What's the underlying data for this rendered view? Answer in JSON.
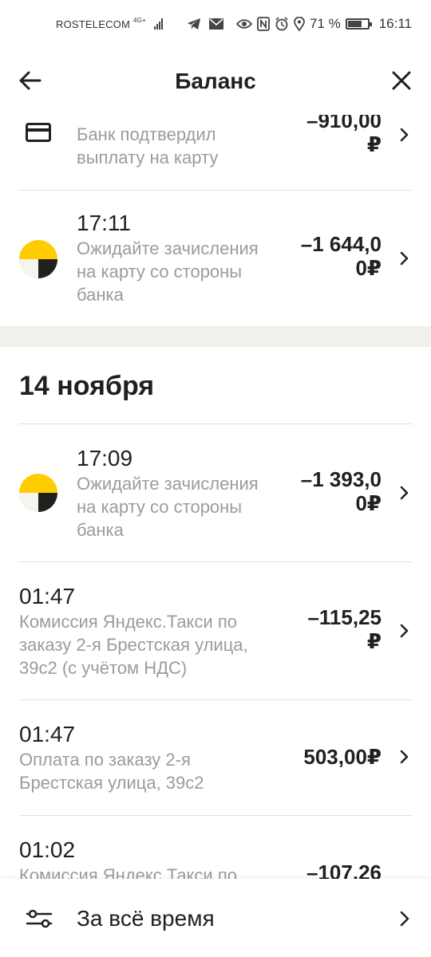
{
  "status": {
    "carrier": "ROSTELECOM",
    "network": "4G+",
    "battery": "71 %",
    "time": "16:11"
  },
  "header": {
    "title": "Баланс"
  },
  "rows_top": [
    {
      "icon": "card-icon",
      "time": "",
      "desc": "Банк подтвердил выплату на карту",
      "amount_line1": "–910,00",
      "amount_line2": "₽"
    },
    {
      "icon": "yandex-logo-icon",
      "time": "17:11",
      "desc": "Ожидайте зачисления на карту со стороны банка",
      "amount_line1": "–1 644,0",
      "amount_line2": "0₽"
    }
  ],
  "section": {
    "date": "14 ноября"
  },
  "rows": [
    {
      "icon": "yandex-logo-icon",
      "time": "17:09",
      "desc": "Ожидайте зачисления на карту со стороны банка",
      "amount_line1": "–1 393,0",
      "amount_line2": "0₽"
    },
    {
      "icon": "",
      "time": "01:47",
      "desc": "Комиссия Яндекс.Такси по заказу 2-я Брестская улица, 39с2 (с учётом НДС)",
      "amount_line1": "–115,25",
      "amount_line2": "₽"
    },
    {
      "icon": "",
      "time": "01:47",
      "desc": "Оплата по заказу 2-я Брестская улица, 39с2",
      "amount_line1": "503,00₽",
      "amount_line2": ""
    },
    {
      "icon": "",
      "time": "01:02",
      "desc": "Комиссия Яндекс.Такси по",
      "amount_line1": "–107,26",
      "amount_line2": ""
    }
  ],
  "footer": {
    "label": "За всё время"
  }
}
